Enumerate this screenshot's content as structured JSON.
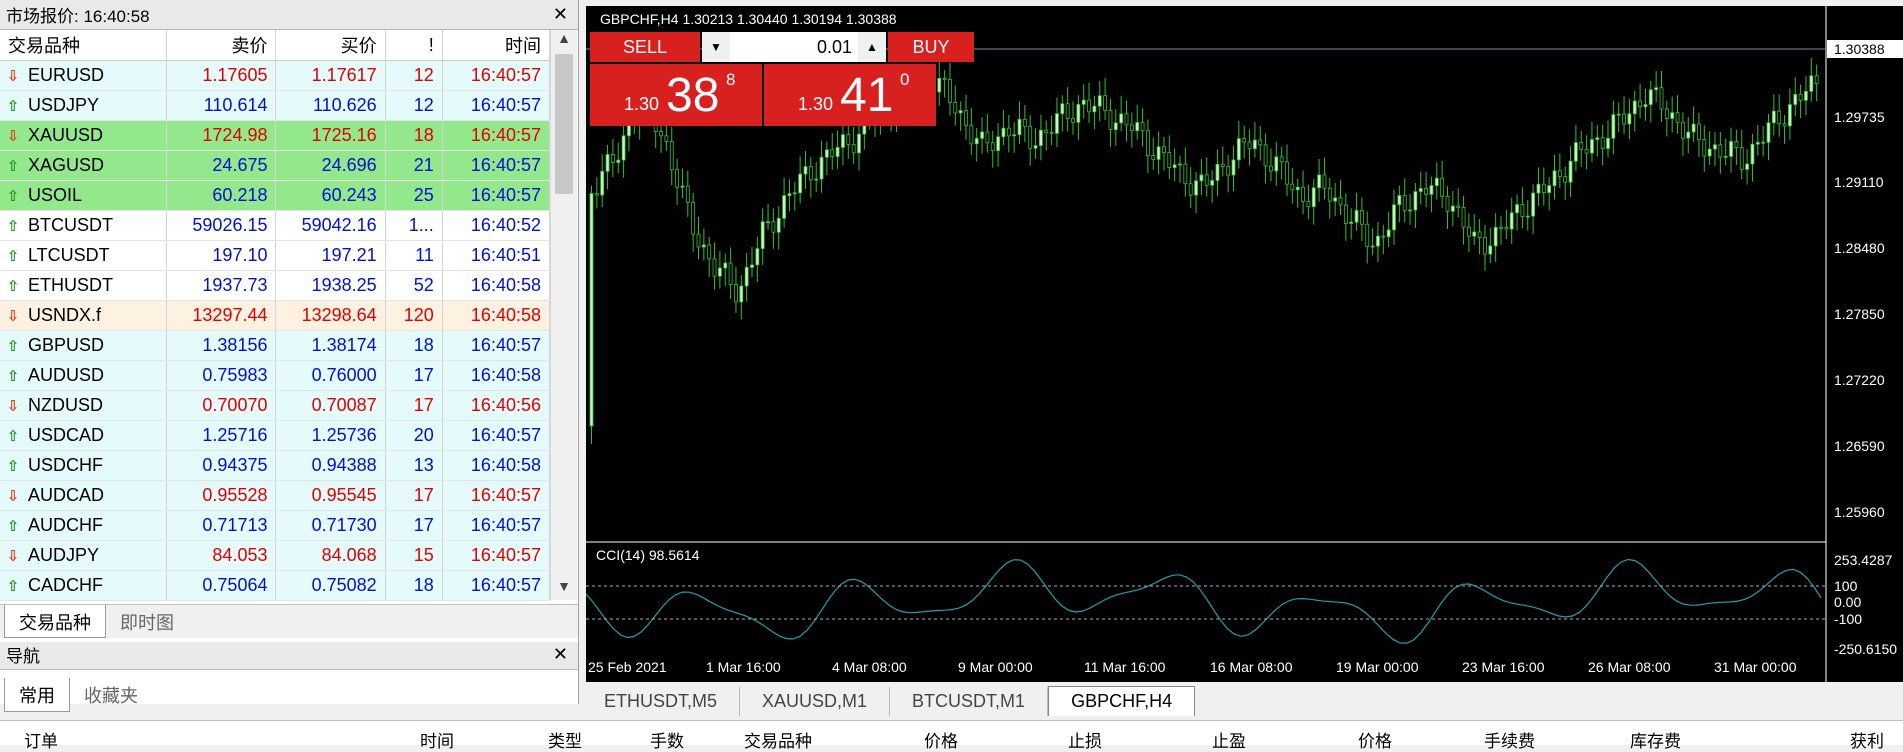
{
  "market_watch": {
    "title": "市场报价: 16:40:58",
    "columns": [
      "交易品种",
      "卖价",
      "买价",
      "!",
      "时间"
    ],
    "rows": [
      {
        "symbol": "EURUSD",
        "bid": "1.17605",
        "ask": "1.17617",
        "spread": "12",
        "time": "16:40:57",
        "dir": "down",
        "color": "#e00000",
        "bg": "#e4fafb"
      },
      {
        "symbol": "USDJPY",
        "bid": "110.614",
        "ask": "110.626",
        "spread": "12",
        "time": "16:40:57",
        "dir": "up",
        "color": "#0010d0",
        "bg": "#e4fafb"
      },
      {
        "symbol": "XAUUSD",
        "bid": "1724.98",
        "ask": "1725.16",
        "spread": "18",
        "time": "16:40:57",
        "dir": "down",
        "color": "#e00000",
        "bg": "#92e88a"
      },
      {
        "symbol": "XAGUSD",
        "bid": "24.675",
        "ask": "24.696",
        "spread": "21",
        "time": "16:40:57",
        "dir": "up",
        "color": "#0010d0",
        "bg": "#92e88a"
      },
      {
        "symbol": "USOIL",
        "bid": "60.218",
        "ask": "60.243",
        "spread": "25",
        "time": "16:40:57",
        "dir": "up",
        "color": "#0010d0",
        "bg": "#92e88a"
      },
      {
        "symbol": "BTCUSDT",
        "bid": "59026.15",
        "ask": "59042.16",
        "spread": "1...",
        "time": "16:40:52",
        "dir": "up",
        "color": "#0010d0",
        "bg": "#ffffff"
      },
      {
        "symbol": "LTCUSDT",
        "bid": "197.10",
        "ask": "197.21",
        "spread": "11",
        "time": "16:40:51",
        "dir": "up",
        "color": "#0010d0",
        "bg": "#ffffff"
      },
      {
        "symbol": "ETHUSDT",
        "bid": "1937.73",
        "ask": "1938.25",
        "spread": "52",
        "time": "16:40:58",
        "dir": "up",
        "color": "#0010d0",
        "bg": "#ffffff"
      },
      {
        "symbol": "USNDX.f",
        "bid": "13297.44",
        "ask": "13298.64",
        "spread": "120",
        "time": "16:40:58",
        "dir": "down",
        "color": "#e00000",
        "bg": "#fdf1e1"
      },
      {
        "symbol": "GBPUSD",
        "bid": "1.38156",
        "ask": "1.38174",
        "spread": "18",
        "time": "16:40:57",
        "dir": "up",
        "color": "#0010d0",
        "bg": "#e4fafb"
      },
      {
        "symbol": "AUDUSD",
        "bid": "0.75983",
        "ask": "0.76000",
        "spread": "17",
        "time": "16:40:58",
        "dir": "up",
        "color": "#0010d0",
        "bg": "#e4fafb"
      },
      {
        "symbol": "NZDUSD",
        "bid": "0.70070",
        "ask": "0.70087",
        "spread": "17",
        "time": "16:40:56",
        "dir": "down",
        "color": "#e00000",
        "bg": "#e4fafb"
      },
      {
        "symbol": "USDCAD",
        "bid": "1.25716",
        "ask": "1.25736",
        "spread": "20",
        "time": "16:40:57",
        "dir": "up",
        "color": "#0010d0",
        "bg": "#e4fafb"
      },
      {
        "symbol": "USDCHF",
        "bid": "0.94375",
        "ask": "0.94388",
        "spread": "13",
        "time": "16:40:58",
        "dir": "up",
        "color": "#0010d0",
        "bg": "#e4fafb"
      },
      {
        "symbol": "AUDCAD",
        "bid": "0.95528",
        "ask": "0.95545",
        "spread": "17",
        "time": "16:40:57",
        "dir": "down",
        "color": "#e00000",
        "bg": "#e4fafb"
      },
      {
        "symbol": "AUDCHF",
        "bid": "0.71713",
        "ask": "0.71730",
        "spread": "17",
        "time": "16:40:57",
        "dir": "up",
        "color": "#0010d0",
        "bg": "#e4fafb"
      },
      {
        "symbol": "AUDJPY",
        "bid": "84.053",
        "ask": "84.068",
        "spread": "15",
        "time": "16:40:57",
        "dir": "down",
        "color": "#e00000",
        "bg": "#e4fafb"
      },
      {
        "symbol": "CADCHF",
        "bid": "0.75064",
        "ask": "0.75082",
        "spread": "18",
        "time": "16:40:57",
        "dir": "up",
        "color": "#0010d0",
        "bg": "#e4fafb"
      }
    ],
    "tabs": [
      "交易品种",
      "即时图"
    ]
  },
  "navigator": {
    "title": "导航",
    "tabs": [
      "常用",
      "收藏夹"
    ]
  },
  "chart": {
    "header": "GBPCHF,H4  1.30213 1.30440 1.30194 1.30388",
    "trade_panel": {
      "sell_label": "SELL",
      "buy_label": "BUY",
      "lot": "0.01",
      "sell_prefix": "1.30",
      "sell_big": "38",
      "sell_small": "8",
      "buy_prefix": "1.30",
      "buy_big": "41",
      "buy_small": "0"
    },
    "price_ticks": [
      "1.30388",
      "1.29735",
      "1.29110",
      "1.28480",
      "1.27850",
      "1.27220",
      "1.26590",
      "1.25960"
    ],
    "cci_label": "CCI(14) 98.5614",
    "cci_ticks": [
      "253.4287",
      "100",
      "0.00",
      "-100",
      "-250.6150"
    ],
    "time_ticks": [
      "25 Feb 2021",
      "1 Mar 16:00",
      "4 Mar 08:00",
      "9 Mar 00:00",
      "11 Mar 16:00",
      "16 Mar 08:00",
      "19 Mar 00:00",
      "23 Mar 16:00",
      "26 Mar 08:00",
      "31 Mar 00:00"
    ],
    "colors": {
      "bull": "#c8f5c0",
      "bear": "#000000",
      "wick": "#32c032",
      "cci": "#1fa0b0"
    }
  },
  "chart_tabs": [
    "ETHUSDT,M5",
    "XAUUSD,M1",
    "BTCUSDT,M1",
    "GBPCHF,H4"
  ],
  "terminal": {
    "columns": [
      "订单",
      "时间",
      "类型",
      "手数",
      "交易品种",
      "价格",
      "止损",
      "止盈",
      "价格",
      "手续费",
      "库存费",
      "获利"
    ]
  }
}
